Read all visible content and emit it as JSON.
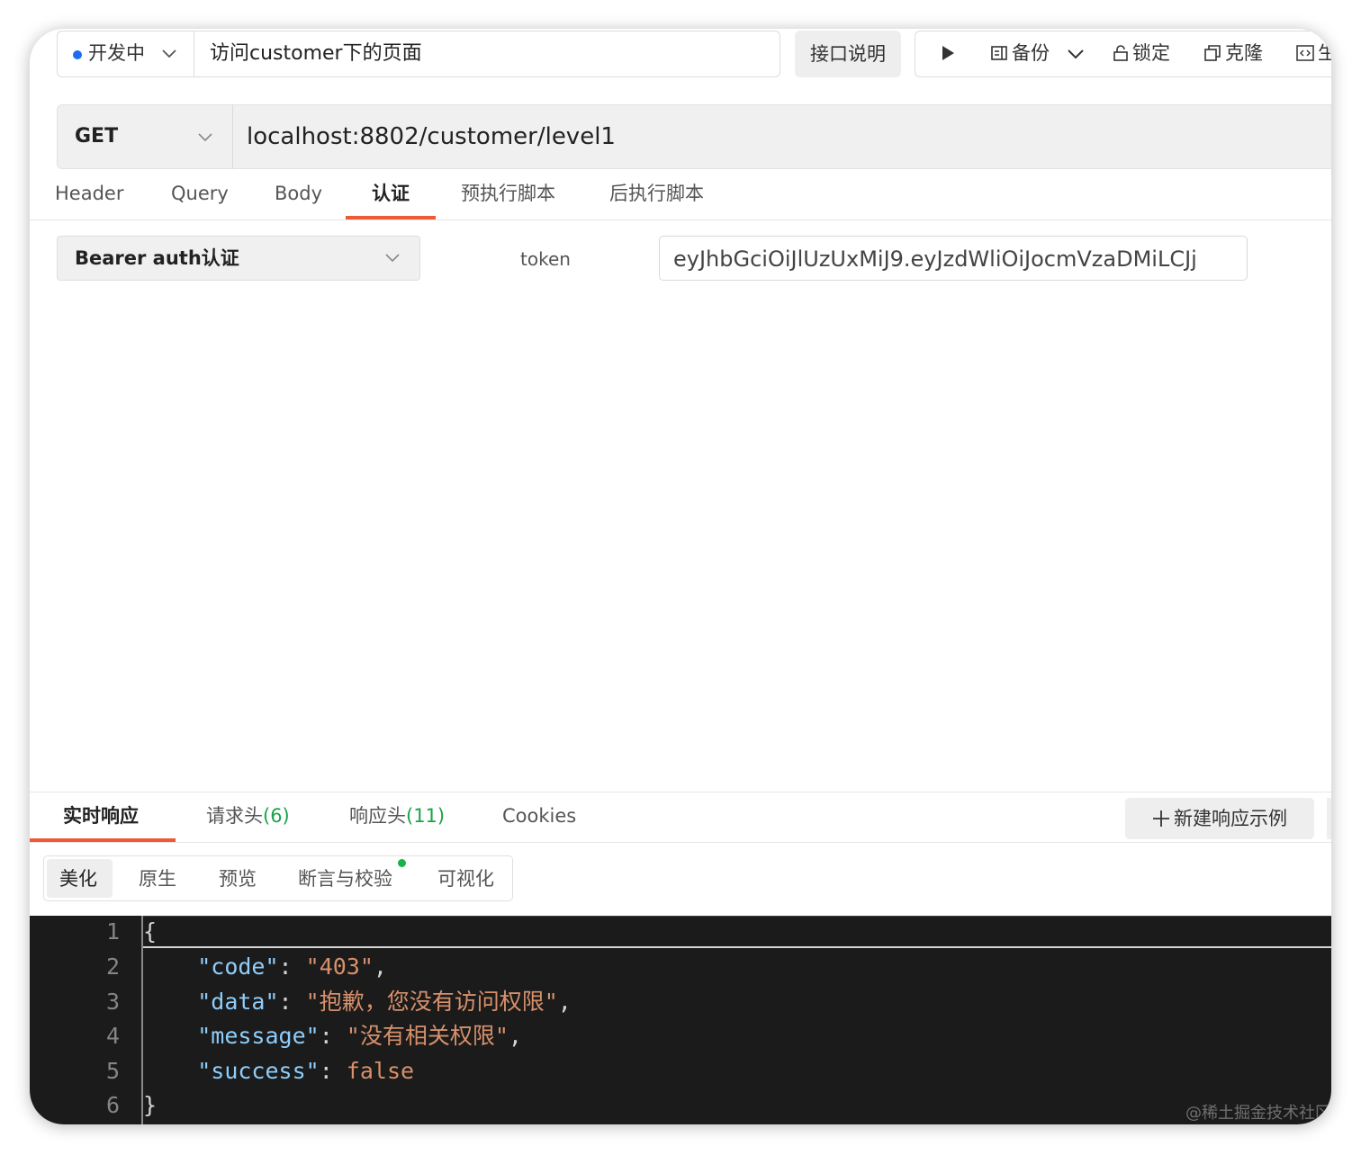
{
  "header": {
    "status_label": "开发中",
    "api_name": "访问customer下的页面",
    "doc_button": "接口说明",
    "toolbar": {
      "backup_label": "备份",
      "lock_label": "锁定",
      "clone_label": "克隆",
      "generate_label": "生"
    }
  },
  "request": {
    "method": "GET",
    "url": "localhost:8802/customer/level1",
    "tabs": [
      "Header",
      "Query",
      "Body",
      "认证",
      "预执行脚本",
      "后执行脚本"
    ],
    "active_tab": "认证"
  },
  "auth": {
    "type": "Bearer auth认证",
    "token_label": "token",
    "token_value": "eyJhbGciOiJlUzUxMiJ9.eyJzdWliOiJocmVzaDMiLCJj"
  },
  "response": {
    "tabs": [
      {
        "label": "实时响应",
        "count": ""
      },
      {
        "label": "请求头",
        "count": "(6)"
      },
      {
        "label": "响应头",
        "count": "(11)"
      },
      {
        "label": "Cookies",
        "count": ""
      }
    ],
    "new_example_button": "新建响应示例",
    "views": [
      "美化",
      "原生",
      "预览",
      "断言与校验",
      "可视化"
    ],
    "active_view": "美化",
    "code": {
      "line_numbers": [
        "1",
        "2",
        "3",
        "4",
        "5",
        "6"
      ],
      "open_brace": "{",
      "close_brace": "}",
      "fields": [
        {
          "key": "\"code\"",
          "value": "\"403\"",
          "trailing": ","
        },
        {
          "key": "\"data\"",
          "value": "\"抱歉，您没有访问权限\"",
          "trailing": ","
        },
        {
          "key": "\"message\"",
          "value": "\"没有相关权限\"",
          "trailing": ","
        },
        {
          "key": "\"success\"",
          "value": "false",
          "trailing": ""
        }
      ]
    }
  },
  "watermark": "@稀土掘金技术社区",
  "colors": {
    "accent": "#ee5a36",
    "status_dot": "#1e6bf2",
    "count_green": "#1aa34a",
    "json_key": "#8fcdfb",
    "json_value": "#d7906b",
    "code_bg": "#1b1b1b"
  },
  "icons": [
    "chevron-down-icon",
    "play-icon",
    "backup-icon",
    "lock-icon",
    "clone-icon",
    "code-icon",
    "plus-icon"
  ]
}
